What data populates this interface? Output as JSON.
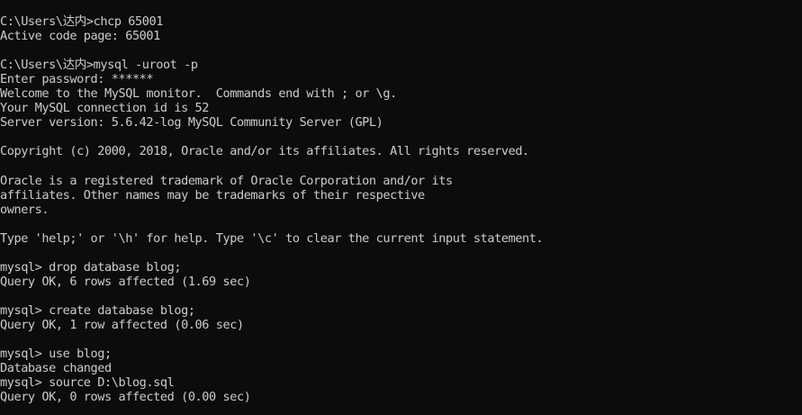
{
  "console": {
    "lines": [
      "C:\\Users\\达内>chcp 65001",
      "Active code page: 65001",
      "",
      "C:\\Users\\达内>mysql -uroot -p",
      "Enter password: ******",
      "Welcome to the MySQL monitor.  Commands end with ; or \\g.",
      "Your MySQL connection id is 52",
      "Server version: 5.6.42-log MySQL Community Server (GPL)",
      "",
      "Copyright (c) 2000, 2018, Oracle and/or its affiliates. All rights reserved.",
      "",
      "Oracle is a registered trademark of Oracle Corporation and/or its",
      "affiliates. Other names may be trademarks of their respective",
      "owners.",
      "",
      "Type 'help;' or '\\h' for help. Type '\\c' to clear the current input statement.",
      "",
      "mysql> drop database blog;",
      "Query OK, 6 rows affected (1.69 sec)",
      "",
      "mysql> create database blog;",
      "Query OK, 1 row affected (0.06 sec)",
      "",
      "mysql> use blog;",
      "Database changed",
      "mysql> source D:\\blog.sql",
      "Query OK, 0 rows affected (0.00 sec)"
    ]
  },
  "colors": {
    "background": "#0c0c0c",
    "text": "#cccccc"
  }
}
